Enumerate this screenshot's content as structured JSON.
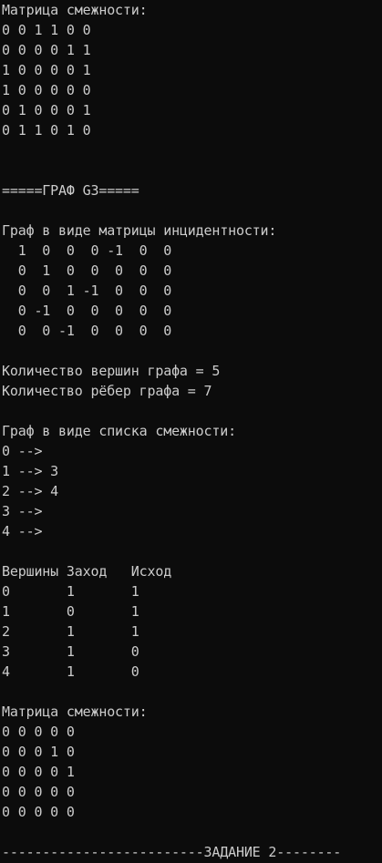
{
  "console": {
    "lines": [
      "Матрица смежности:",
      "0 0 1 1 0 0",
      "0 0 0 0 1 1",
      "1 0 0 0 0 1",
      "1 0 0 0 0 0",
      "0 1 0 0 0 1",
      "0 1 1 0 1 0",
      "",
      "",
      "=====ГРАФ G3=====",
      "",
      "Граф в виде матрицы инцидентности:",
      "  1  0  0  0 -1  0  0",
      "  0  1  0  0  0  0  0",
      "  0  0  1 -1  0  0  0",
      "  0 -1  0  0  0  0  0",
      "  0  0 -1  0  0  0  0",
      "",
      "Количество вершин графа = 5",
      "Количество рёбер графа = 7",
      "",
      "Граф в виде списка смежности:",
      "0 -->",
      "1 --> 3",
      "2 --> 4",
      "3 -->",
      "4 -->",
      "",
      "Вершины Заход   Исход",
      "0       1       1",
      "1       0       1",
      "2       1       1",
      "3       1       0",
      "4       1       0",
      "",
      "Матрица смежности:",
      "0 0 0 0 0",
      "0 0 0 1 0",
      "0 0 0 0 1",
      "0 0 0 0 0",
      "0 0 0 0 0",
      "",
      "-------------------------ЗАДАНИЕ 2--------"
    ]
  }
}
